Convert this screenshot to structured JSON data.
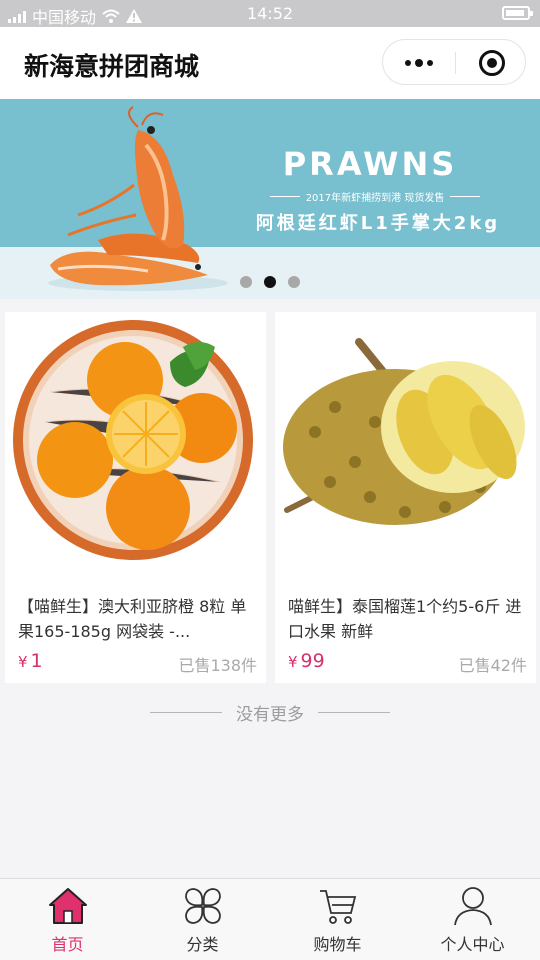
{
  "status_bar": {
    "carrier": "中国移动",
    "time": "14:52"
  },
  "header": {
    "title": "新海意拼团商城"
  },
  "banner": {
    "headline": "PRAWNS",
    "subline": "2017年新虾捕捞到港 现货发售",
    "product": "阿根廷红虾L1手掌大2kg",
    "slide_count": 3,
    "active_slide": 2
  },
  "products": [
    {
      "name": "【喵鲜生】澳大利亚脐橙 8粒 单果165-185g 网袋装 -...",
      "currency": "¥",
      "price": "1",
      "sold": "已售138件"
    },
    {
      "name": "喵鲜生】泰国榴莲1个约5-6斤 进口水果 新鲜",
      "currency": "¥",
      "price": "99",
      "sold": "已售42件"
    }
  ],
  "footer_note": "没有更多",
  "tabbar": [
    {
      "label": "首页",
      "icon": "home-icon",
      "active": true
    },
    {
      "label": "分类",
      "icon": "category-icon",
      "active": false
    },
    {
      "label": "购物车",
      "icon": "cart-icon",
      "active": false
    },
    {
      "label": "个人中心",
      "icon": "user-icon",
      "active": false
    }
  ],
  "colors": {
    "accent": "#e0306e",
    "banner_bg": "#78bfcf"
  }
}
